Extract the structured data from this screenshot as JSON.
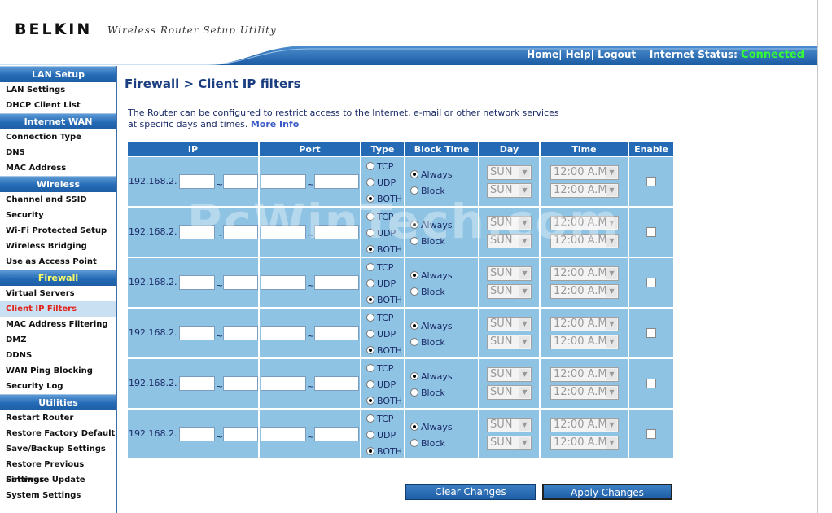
{
  "header": {
    "brand": "BELKIN",
    "utility_title": "Wireless Router Setup Utility",
    "nav_home": "Home|",
    "nav_help": "Help|",
    "nav_logout": "Logout",
    "status_label": "Internet Status:",
    "status_value": "Connected"
  },
  "sidebar": {
    "sections": [
      {
        "title": "LAN Setup",
        "items": [
          "LAN Settings",
          "DHCP Client List"
        ]
      },
      {
        "title": "Internet WAN",
        "items": [
          "Connection Type",
          "DNS",
          "MAC Address"
        ]
      },
      {
        "title": "Wireless",
        "items": [
          "Channel and SSID",
          "Security",
          "Wi-Fi Protected Setup",
          "Wireless Bridging",
          "Use as Access Point"
        ]
      },
      {
        "title": "Firewall",
        "items": [
          "Virtual Servers",
          "Client IP Filters",
          "MAC Address Filtering",
          "DMZ",
          "DDNS",
          "WAN Ping Blocking",
          "Security Log"
        ]
      },
      {
        "title": "Utilities",
        "items": [
          "Restart Router",
          "Restore Factory Default",
          "Save/Backup Settings",
          "Restore Previous Settings",
          "Firmware Update",
          "System Settings"
        ]
      }
    ],
    "active_section": "Firewall",
    "current_item": "Client IP Filters"
  },
  "main": {
    "title": "Firewall > Client IP filters",
    "description_line1": "The Router can be configured to restrict access to the Internet, e-mail or other network services",
    "description_line2": "at specific days and times.",
    "more_info": "More Info",
    "watermark": "PcWinTech.com"
  },
  "table": {
    "headers": {
      "ip": "IP",
      "port": "Port",
      "type": "Type",
      "block_time": "Block Time",
      "day": "Day",
      "time": "Time",
      "enable": "Enable"
    },
    "ip_prefix": "192.168.2.",
    "range_sep": "~",
    "type_options": {
      "tcp": "TCP",
      "udp": "UDP",
      "both": "BOTH"
    },
    "block_options": {
      "always": "Always",
      "block": "Block"
    },
    "day_value": "SUN",
    "time_value": "12:00 A.M.",
    "row_count": 6
  },
  "buttons": {
    "clear": "Clear Changes",
    "apply": "Apply Changes"
  }
}
